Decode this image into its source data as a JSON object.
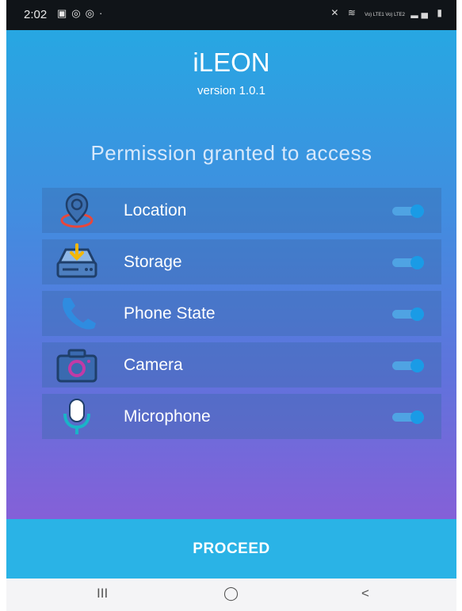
{
  "status_bar": {
    "time": "2:02",
    "left_icons": [
      "image-icon",
      "instagram-icon",
      "instagram-icon",
      "dot-icon"
    ],
    "right_text": "Vo) LTE1 Vo) LTE2",
    "right_icons": [
      "mute-icon",
      "wifi-icon",
      "signal-icon",
      "signal-icon",
      "battery-icon"
    ]
  },
  "app": {
    "title": "iLEON",
    "version": "version 1.0.1"
  },
  "heading": "Permission granted to access",
  "permissions": [
    {
      "label": "Location",
      "icon": "location-pin-icon",
      "enabled": true
    },
    {
      "label": "Storage",
      "icon": "storage-icon",
      "enabled": true
    },
    {
      "label": "Phone State",
      "icon": "phone-icon",
      "enabled": true
    },
    {
      "label": "Camera",
      "icon": "camera-icon",
      "enabled": true
    },
    {
      "label": "Microphone",
      "icon": "microphone-icon",
      "enabled": true
    }
  ],
  "proceed_label": "PROCEED",
  "nav": {
    "recents": "III",
    "home": "◯",
    "back": "<"
  },
  "colors": {
    "status_bar": "#101418",
    "gradient_top": "#27a7e2",
    "gradient_bottom": "#8560d8",
    "row_background": "#3a68a8",
    "toggle_on": "#1a9be6",
    "proceed_bg": "#2ab3e6",
    "nav_bg": "#f4f4f6"
  }
}
